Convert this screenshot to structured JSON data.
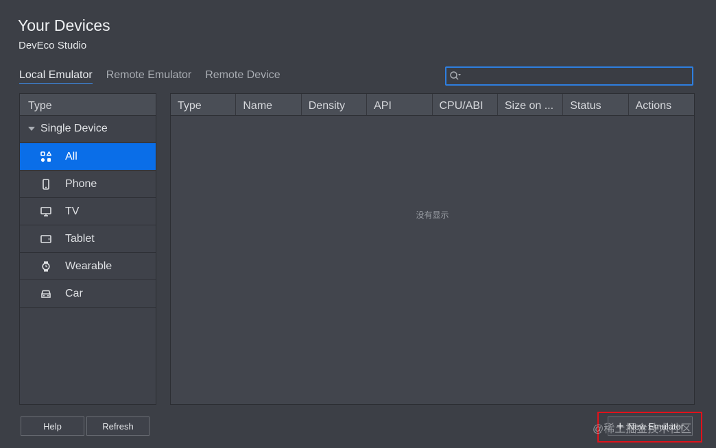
{
  "header": {
    "title": "Your Devices",
    "subtitle": "DevEco Studio"
  },
  "tabs": [
    {
      "label": "Local Emulator",
      "active": true
    },
    {
      "label": "Remote Emulator",
      "active": false
    },
    {
      "label": "Remote Device",
      "active": false
    }
  ],
  "search": {
    "value": "",
    "placeholder": ""
  },
  "sidebar": {
    "header": "Type",
    "group": "Single Device",
    "items": [
      {
        "label": "All",
        "icon": "grid-icon",
        "selected": true
      },
      {
        "label": "Phone",
        "icon": "phone-icon",
        "selected": false
      },
      {
        "label": "TV",
        "icon": "tv-icon",
        "selected": false
      },
      {
        "label": "Tablet",
        "icon": "tablet-icon",
        "selected": false
      },
      {
        "label": "Wearable",
        "icon": "watch-icon",
        "selected": false
      },
      {
        "label": "Car",
        "icon": "car-icon",
        "selected": false
      }
    ]
  },
  "table": {
    "columns": [
      "Type",
      "Name",
      "Density",
      "API",
      "CPU/ABI",
      "Size on ...",
      "Status",
      "Actions"
    ],
    "empty_text": "没有显示"
  },
  "footer": {
    "help_label": "Help",
    "refresh_label": "Refresh",
    "new_emulator_label": "New Emulator"
  },
  "watermark": "@稀土掘金技术社区",
  "colors": {
    "accent": "#0a6ee8",
    "highlight": "#e0121b",
    "background": "#3c3f46"
  }
}
